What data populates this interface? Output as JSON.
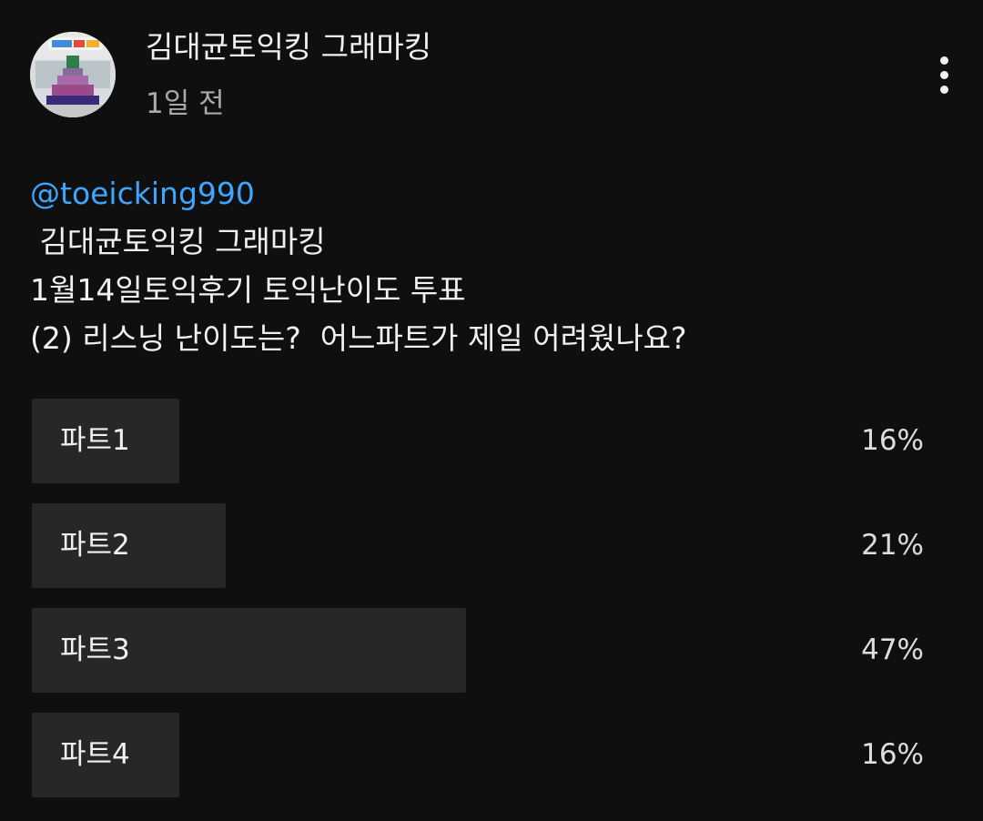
{
  "post": {
    "author": "김대균토익킹 그래마킹",
    "time": "1일 전",
    "more_icon": "more-vertical-icon",
    "mention": "@toeicking990",
    "lines": [
      " 김대균토익킹 그래마킹",
      "1월14일토익후기 토익난이도 투표",
      "(2) 리스닝 난이도는?  어느파트가 제일 어려웠나요?"
    ]
  },
  "poll": {
    "options": [
      {
        "label": "파트1",
        "percent_text": "16%",
        "value": 16
      },
      {
        "label": "파트2",
        "percent_text": "21%",
        "value": 21
      },
      {
        "label": "파트3",
        "percent_text": "47%",
        "value": 47
      },
      {
        "label": "파트4",
        "percent_text": "16%",
        "value": 16
      }
    ]
  },
  "colors": {
    "background": "#0f0f0f",
    "bar": "#272727",
    "mention": "#3ea6ff",
    "secondary_text": "#aaaaaa"
  }
}
